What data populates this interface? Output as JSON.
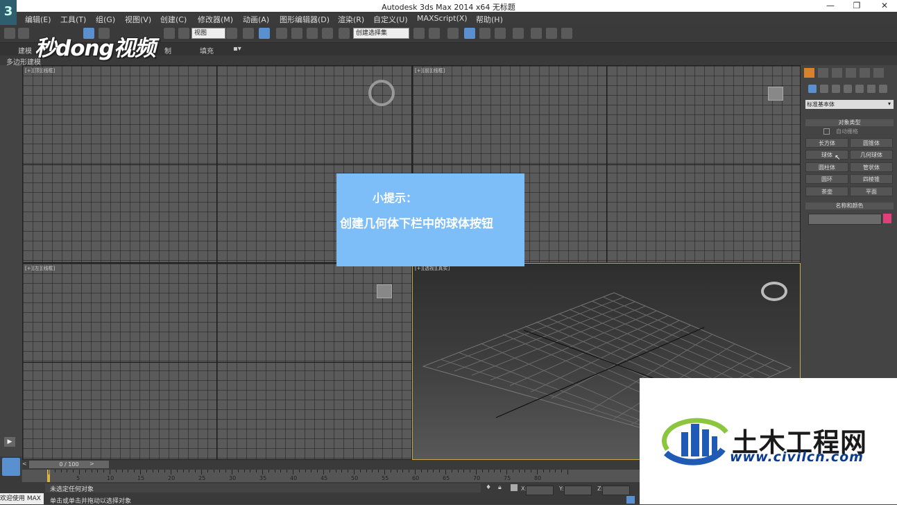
{
  "window": {
    "title": "Autodesk 3ds Max  2014 x64    无标题",
    "min": "—",
    "max": "❐",
    "close": "✕"
  },
  "menu": [
    "编辑(E)",
    "工具(T)",
    "组(G)",
    "视图(V)",
    "创建(C)",
    "修改器(M)",
    "动画(A)",
    "图形编辑器(D)",
    "渲染(R)",
    "自定义(U)",
    "MAXScript(X)",
    "帮助(H)"
  ],
  "toolbar": {
    "view_select": "视图",
    "selection_set": "创建选择集"
  },
  "ribbon": {
    "tab1": "建模",
    "tab2": "制",
    "tab3": "填充",
    "sub": "多边形建模"
  },
  "watermark": "秒dong视频",
  "viewports": {
    "top": "[+][顶][线框]",
    "front": "[+][前][线框]",
    "left": "[+][左][线框]",
    "persp": "[+][透视][真实]"
  },
  "hint": {
    "title": "小提示：",
    "text": "创建几何体下栏中的球体按钮"
  },
  "command_panel": {
    "dropdown": "标准基本体",
    "rollout_object_type": "对象类型",
    "autogrid": "自动栅格",
    "buttons": [
      "长方体",
      "圆锥体",
      "球体",
      "几何球体",
      "圆柱体",
      "管状体",
      "圆环",
      "四棱锥",
      "茶壶",
      "平面"
    ],
    "rollout_name_color": "名称和颜色",
    "color": "#e0407a"
  },
  "timeline": {
    "frame": "0 / 100",
    "ticks": [
      "5",
      "10",
      "15",
      "20",
      "25",
      "30",
      "35",
      "40",
      "45",
      "50",
      "55",
      "60",
      "65",
      "70",
      "75",
      "80"
    ]
  },
  "status": {
    "none_selected": "未选定任何对象",
    "prompt": "单击或单击并拖动以选择对象",
    "welcome": "欢迎使用 MAX",
    "x": "X:",
    "y": "Y:",
    "z": "Z:"
  },
  "site_logo": {
    "name": "土木工程网",
    "url": "www.civilcn.com"
  }
}
